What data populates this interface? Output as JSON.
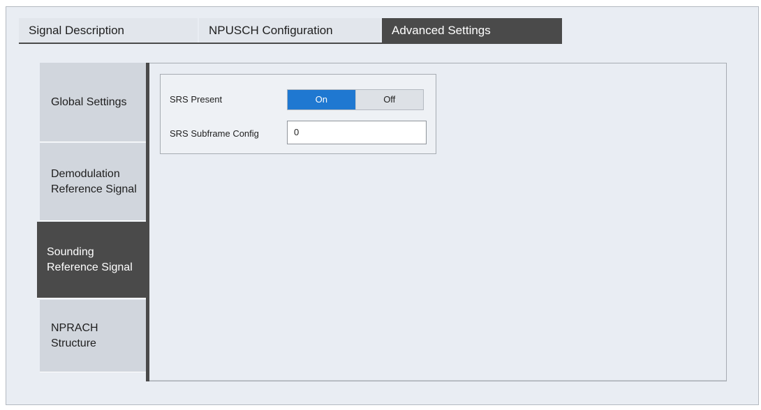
{
  "tabs": [
    {
      "label": "Signal Description"
    },
    {
      "label": "NPUSCH Configuration"
    },
    {
      "label": "Advanced Settings"
    }
  ],
  "active_tab": "Advanced Settings",
  "sidebar": {
    "items": [
      {
        "label": "Global Settings"
      },
      {
        "label": "Demodulation Reference Signal"
      },
      {
        "label": "Sounding Reference Signal"
      },
      {
        "label": "NPRACH Structure"
      }
    ],
    "active": "Sounding Reference Signal"
  },
  "srs": {
    "present_label": "SRS Present",
    "present_on": "On",
    "present_off": "Off",
    "present_selected": "On",
    "subframe_label": "SRS Subframe Config",
    "subframe_value": "0"
  },
  "colors": {
    "accent": "#1f78d1",
    "active_tab_bg": "#4a4a4a",
    "panel_bg": "#e9edf3"
  }
}
